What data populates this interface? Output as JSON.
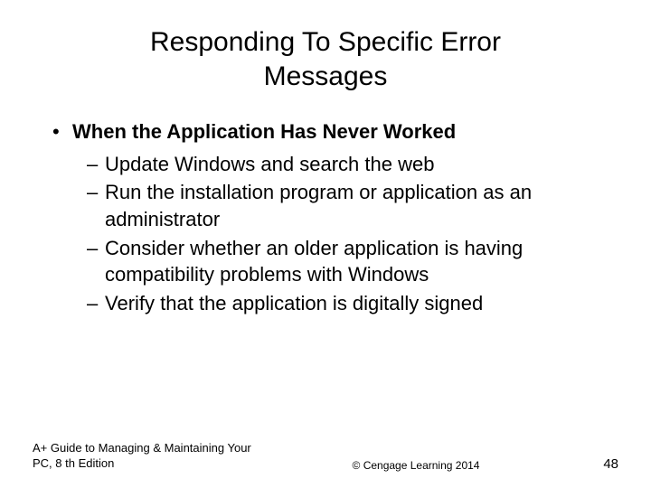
{
  "title_line1": "Responding To Specific Error",
  "title_line2": "Messages",
  "heading": "When the Application Has Never Worked",
  "sub_items": [
    "Update Windows and search the web",
    "Run the installation program or application as an administrator",
    "Consider whether an older application is having compatibility problems with Windows",
    "Verify that the application is digitally signed"
  ],
  "footer_left": "A+ Guide to Managing & Maintaining Your PC, 8 th Edition",
  "footer_center": "© Cengage Learning  2014",
  "page_number": "48"
}
